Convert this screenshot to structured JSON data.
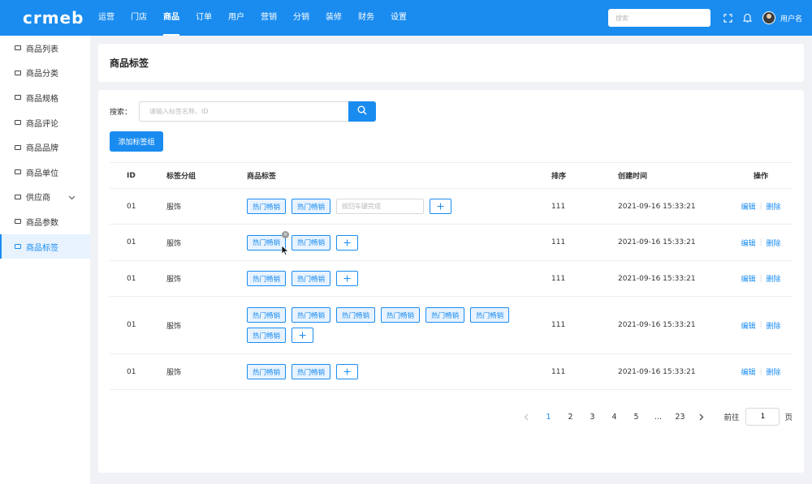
{
  "brand": {
    "logo": "crmeb"
  },
  "topnav": [
    "运营",
    "门店",
    "商品",
    "订单",
    "用户",
    "营销",
    "分销",
    "装修",
    "财务",
    "设置"
  ],
  "topbar": {
    "search_placeholder": "搜索",
    "username": "用户名"
  },
  "sidebar": {
    "items": [
      {
        "label": "商品列表"
      },
      {
        "label": "商品分类"
      },
      {
        "label": "商品规格"
      },
      {
        "label": "商品评论"
      },
      {
        "label": "商品品牌"
      },
      {
        "label": "商品单位"
      },
      {
        "label": "供应商"
      },
      {
        "label": "商品参数"
      },
      {
        "label": "商品标签"
      }
    ],
    "active_index": 8
  },
  "page": {
    "title": "商品标签"
  },
  "search": {
    "label": "搜索：",
    "placeholder": "请输入标签名称、ID"
  },
  "actions": {
    "add_group": "添加标签组"
  },
  "table": {
    "headers": {
      "id": "ID",
      "group": "标签分组",
      "tags": "商品标签",
      "sort": "排序",
      "time": "创建时间",
      "ops": "操作"
    },
    "rows": [
      {
        "id": "01",
        "group": "服饰",
        "tags": [
          "热门畅销",
          "热门畅销"
        ],
        "input_placeholder": "按回车键完成",
        "sort": "111",
        "time": "2021-09-16 15:33:21",
        "edit": "编辑",
        "delete": "删除"
      },
      {
        "id": "01",
        "group": "服饰",
        "tags": [
          "热门畅销",
          "热门畅销"
        ],
        "sort": "111",
        "time": "2021-09-16 15:33:21",
        "edit": "编辑",
        "delete": "删除"
      },
      {
        "id": "01",
        "group": "服饰",
        "tags": [
          "热门畅销",
          "热门畅销"
        ],
        "sort": "111",
        "time": "2021-09-16 15:33:21",
        "edit": "编辑",
        "delete": "删除"
      },
      {
        "id": "01",
        "group": "服饰",
        "tags": [
          "热门畅销",
          "热门畅销",
          "热门畅销",
          "热门畅销",
          "热门畅销",
          "热门畅销",
          "热门畅销"
        ],
        "sort": "111",
        "time": "2021-09-16 15:33:21",
        "edit": "编辑",
        "delete": "删除"
      },
      {
        "id": "01",
        "group": "服饰",
        "tags": [
          "热门畅销",
          "热门畅销"
        ],
        "sort": "111",
        "time": "2021-09-16 15:33:21",
        "edit": "编辑",
        "delete": "删除"
      }
    ]
  },
  "pagination": {
    "pages": [
      "1",
      "2",
      "3",
      "4",
      "5",
      "...",
      "23"
    ],
    "current": "1",
    "goto_label": "前往",
    "goto_value": "1",
    "goto_suffix": "页"
  },
  "colors": {
    "primary": "#1a8cf0",
    "tag_bg": "#e8f3ff"
  }
}
